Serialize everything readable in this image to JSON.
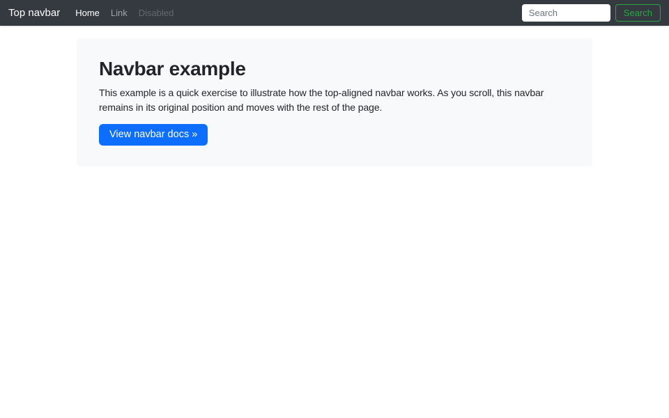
{
  "colors": {
    "navbar_bg": "#343a40",
    "navlink_active": "#ffffff",
    "navlink_default": "#9fa3a8",
    "navlink_disabled": "#65696e",
    "success_green": "#28a745",
    "primary_blue": "#0d6efd",
    "hero_bg": "#f8f9fa",
    "body_bg": "#ffffff",
    "text_dark": "#212529",
    "placeholder_gray": "#6c757d"
  },
  "navbar": {
    "brand": "Top navbar",
    "links": [
      {
        "label": "Home",
        "state": "active"
      },
      {
        "label": "Link",
        "state": "default"
      },
      {
        "label": "Disabled",
        "state": "disabled"
      }
    ],
    "search": {
      "placeholder": "Search",
      "button_label": "Search"
    }
  },
  "hero": {
    "title": "Navbar example",
    "description": "This example is a quick exercise to illustrate how the top-aligned navbar works. As you scroll, this navbar remains in its original position and moves with the rest of the page.",
    "cta_label": "View navbar docs »"
  }
}
